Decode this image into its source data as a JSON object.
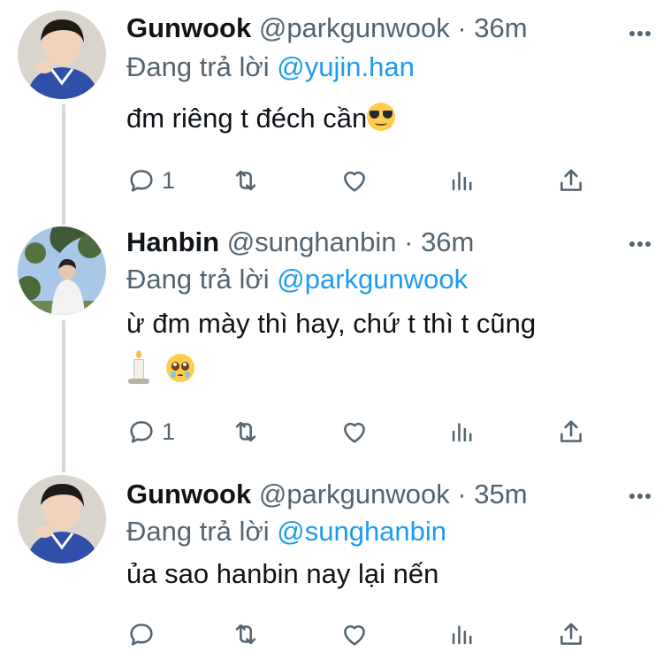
{
  "colors": {
    "text": "#0f1419",
    "muted": "#536471",
    "mention": "#1d9bf0",
    "thread_line": "#cfd9de"
  },
  "tweets": [
    {
      "name": "Gunwook",
      "handle": "@parkgunwook",
      "separator": "·",
      "time": "36m",
      "reply_prefix": "Đang trả lời",
      "reply_mention": "@yujin.han",
      "text": "đm riêng t đéch cần",
      "emoji": "smiling-face-with-sunglasses",
      "reply_count": "1"
    },
    {
      "name": "Hanbin",
      "handle": "@sunghanbin",
      "separator": "·",
      "time": "36m",
      "reply_prefix": "Đang trả lời",
      "reply_mention": "@parkgunwook",
      "text": "ừ đm mày thì hay, chứ t thì t cũng",
      "emoji": "candle, pleading-face",
      "reply_count": "1"
    },
    {
      "name": "Gunwook",
      "handle": "@parkgunwook",
      "separator": "·",
      "time": "35m",
      "reply_prefix": "Đang trả lời",
      "reply_mention": "@sunghanbin",
      "text": "ủa sao hanbin nay lại nến",
      "emoji": "",
      "reply_count": ""
    }
  ],
  "icons": [
    "reply-icon",
    "retweet-icon",
    "like-icon",
    "stats-icon",
    "share-icon",
    "more-icon"
  ]
}
